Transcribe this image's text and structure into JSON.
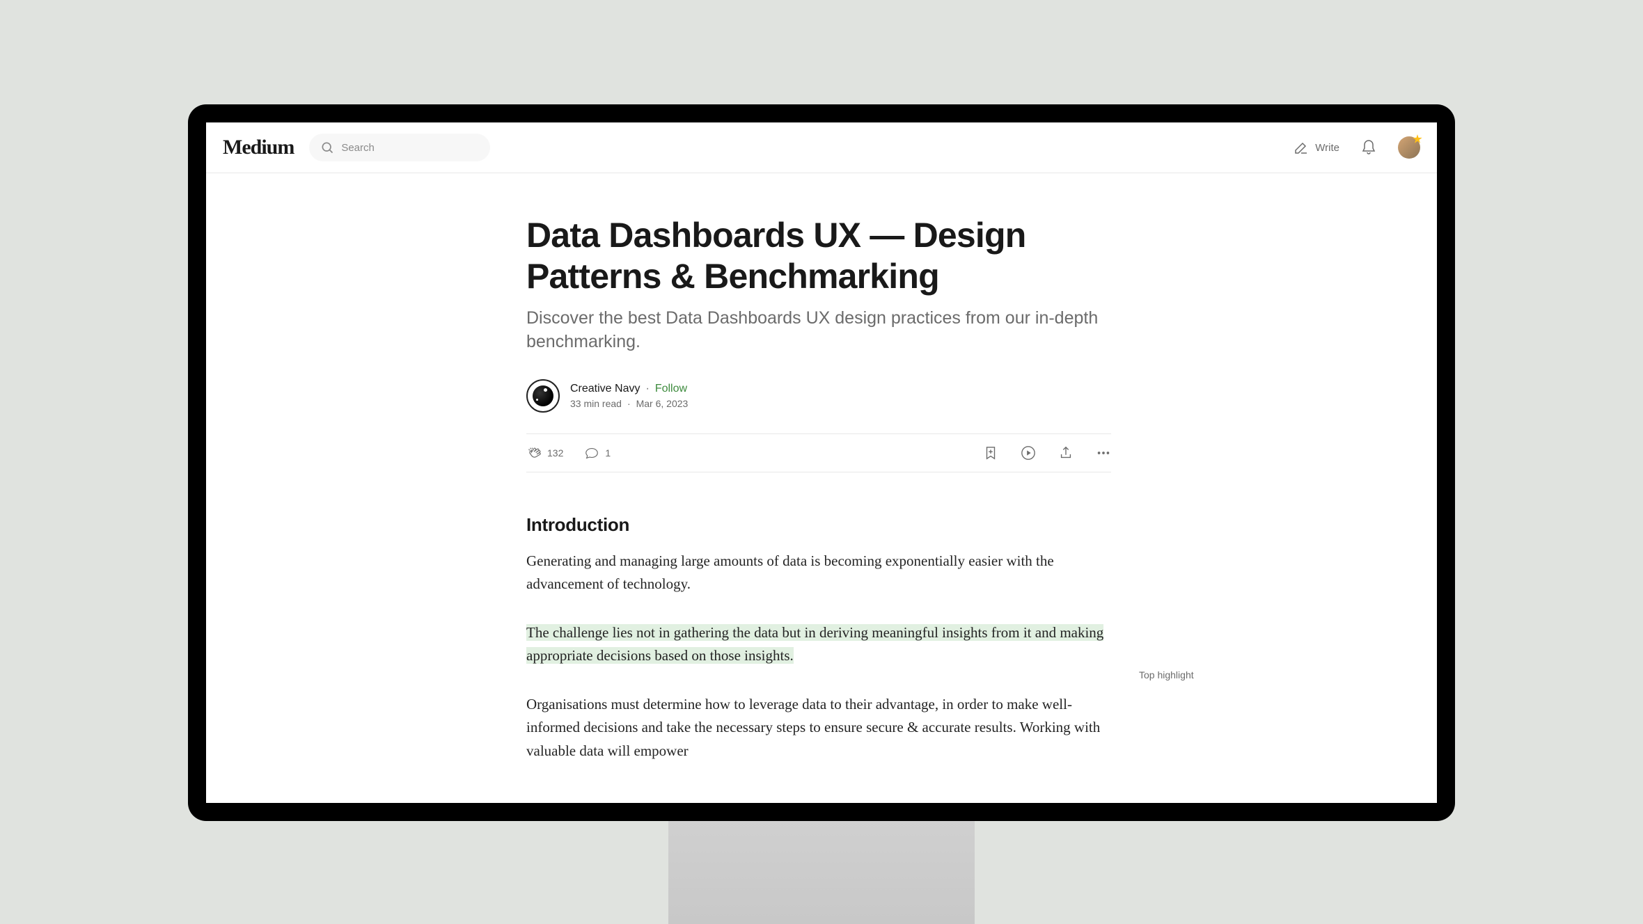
{
  "header": {
    "logo": "Medium",
    "search_placeholder": "Search",
    "write_label": "Write"
  },
  "article": {
    "title": "Data Dashboards UX — Design Patterns & Benchmarking",
    "subtitle": "Discover the best Data Dashboards UX design practices from our in-depth benchmarking.",
    "author_name": "Creative Navy",
    "follow_label": "Follow",
    "read_time": "33 min read",
    "publish_date": "Mar 6, 2023",
    "clap_count": "132",
    "comment_count": "1",
    "section_heading": "Introduction",
    "p1": "Generating and managing large amounts of data is becoming exponentially easier with the advancement of technology.",
    "p2_highlight": "The challenge lies not in gathering the data but in deriving meaningful insights from it and making appropriate decisions based on those insights.",
    "p3": "Organisations must determine how to leverage data to their advantage, in order to make well-informed decisions and take the necessary steps to ensure secure & accurate results. Working with valuable data will empower",
    "top_highlight_label": "Top highlight"
  }
}
